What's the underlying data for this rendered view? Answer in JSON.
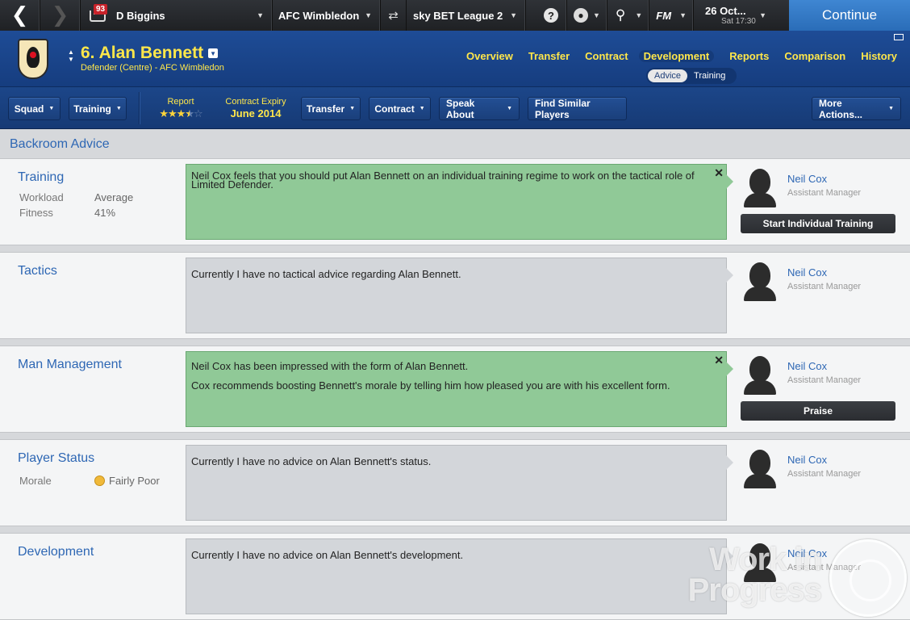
{
  "topbar": {
    "back_icon": "back-arrow-icon",
    "forward_icon": "forward-arrow-icon",
    "inbox_count": "93",
    "manager": "D Biggins",
    "club": "AFC Wimbledon",
    "league": "sky BET League 2",
    "date": "26 Oct...",
    "date_sub": "Sat 17:30",
    "help_icon": "?",
    "fm_label": "FM",
    "continue_label": "Continue"
  },
  "header": {
    "player_title": "6. Alan Bennett",
    "player_sub": "Defender (Centre) - AFC Wimbledon",
    "tabs": [
      {
        "label": "Overview"
      },
      {
        "label": "Transfer"
      },
      {
        "label": "Contract"
      },
      {
        "label": "Development"
      },
      {
        "label": "Reports"
      },
      {
        "label": "Comparison"
      },
      {
        "label": "History"
      }
    ],
    "active_tab": "Development",
    "subtabs": [
      {
        "label": "Advice"
      },
      {
        "label": "Training"
      }
    ],
    "active_subtab": "Advice"
  },
  "actionbar": {
    "squad": "Squad",
    "training": "Training",
    "report_label": "Report",
    "report_stars": 3.5,
    "report_stars_max": 5,
    "contract_label": "Contract Expiry",
    "contract_value": "June 2014",
    "transfer": "Transfer",
    "contract": "Contract",
    "speak_about": "Speak About",
    "find_similar": "Find Similar Players",
    "more_actions": "More Actions..."
  },
  "section_title": "Backroom Advice",
  "panels": [
    {
      "title": "Training",
      "rows": [
        {
          "k": "Workload",
          "v": "Average"
        },
        {
          "k": "Fitness",
          "v": "41%"
        }
      ],
      "messages": [
        "Neil Cox feels that you should put Alan Bennett on an individual training regime to work on the tactical role of Limited Defender."
      ],
      "staff_name": "Neil Cox",
      "staff_role": "Assistant Manager",
      "button": "Start Individual Training"
    },
    {
      "title": "Tactics",
      "messages": [
        "Currently I have no tactical advice regarding Alan Bennett."
      ],
      "staff_name": "Neil Cox",
      "staff_role": "Assistant Manager"
    },
    {
      "title": "Man Management",
      "messages": [
        "Neil Cox has been impressed with the form of Alan Bennett.",
        "Cox recommends boosting Bennett's morale by telling him how pleased you are with his excellent form."
      ],
      "staff_name": "Neil Cox",
      "staff_role": "Assistant Manager",
      "button": "Praise"
    },
    {
      "title": "Player Status",
      "rows": [
        {
          "k": "Morale",
          "v": "Fairly Poor"
        }
      ],
      "messages": [
        "Currently I have no advice on Alan Bennett's status."
      ],
      "staff_name": "Neil Cox",
      "staff_role": "Assistant Manager"
    },
    {
      "title": "Development",
      "messages": [
        "Currently I have no advice on Alan Bennett's development."
      ],
      "staff_name": "Neil Cox",
      "staff_role": "Assistant Manager"
    }
  ],
  "watermark": {
    "line1": "Work in",
    "line2": "Progress"
  },
  "colors": {
    "accent_blue": "#1e4c96",
    "yellow": "#ffe74a",
    "green_msg": "#90c997",
    "continue": "#2a6db8"
  }
}
